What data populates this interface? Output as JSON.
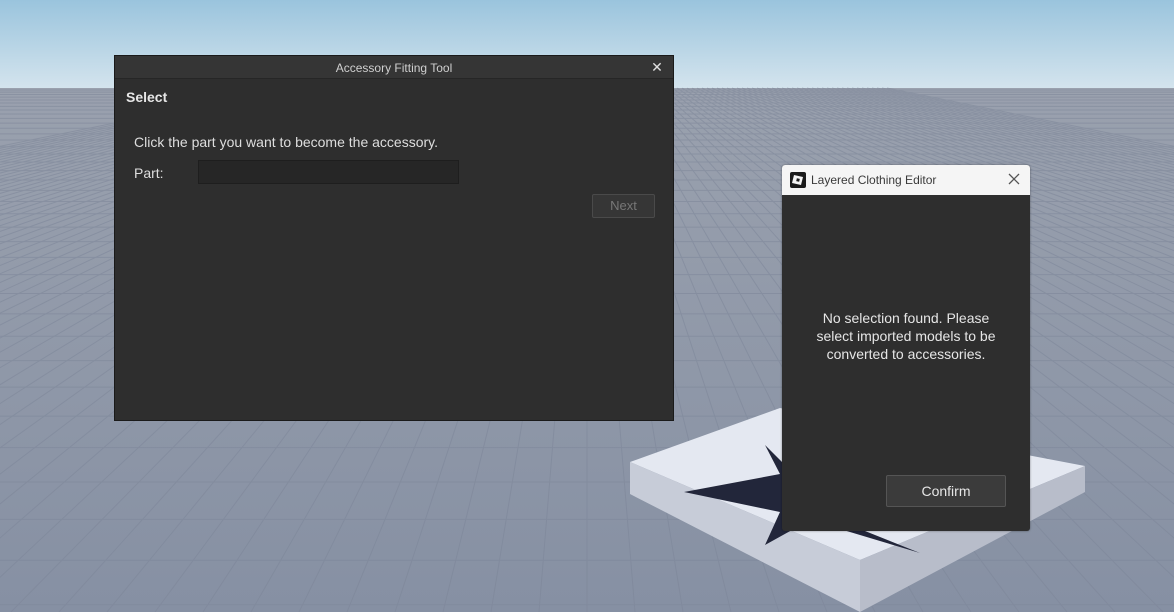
{
  "colors": {
    "sky_top": "#9ec6de",
    "sky_horizon": "#d8e6ee",
    "baseplate": "#8a93a6",
    "grid_line": "#7e889b",
    "window_bg": "#2e2e2e",
    "lce_titlebar": "#f5f5f5"
  },
  "accessory_fitting_tool": {
    "title": "Accessory Fitting Tool",
    "close_glyph": "✕",
    "heading": "Select",
    "instruction": "Click the part you want to become the accessory.",
    "part_label": "Part:",
    "part_value": "",
    "next_label": "Next"
  },
  "layered_clothing_editor": {
    "title": "Layered Clothing Editor",
    "message": "No selection found. Please select imported models to be converted to accessories.",
    "confirm_label": "Confirm",
    "logo_icon": "roblox-studio-logo",
    "close_icon": "close-icon"
  }
}
